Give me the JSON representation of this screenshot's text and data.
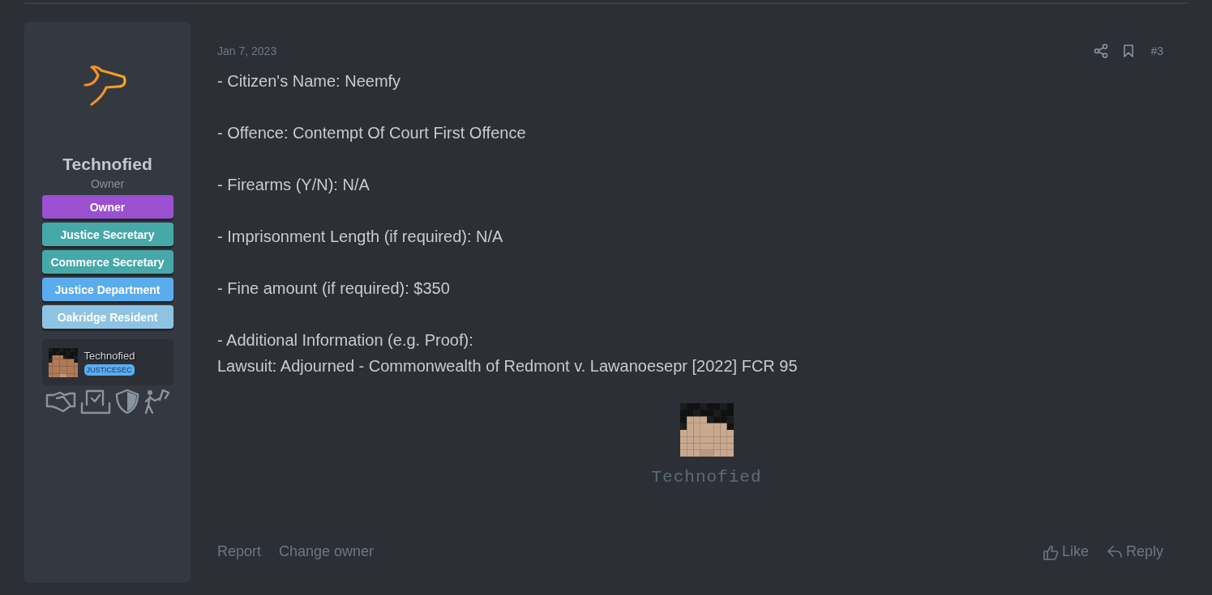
{
  "user": {
    "name": "Technofied",
    "title": "Owner",
    "banners": [
      {
        "label": "Owner",
        "color": "#9b4fd1"
      },
      {
        "label": "Justice Secretary",
        "color": "#46a8a8"
      },
      {
        "label": "Commerce Secretary",
        "color": "#46a8a8"
      },
      {
        "label": "Justice Department",
        "color": "#5aacec"
      },
      {
        "label": "Oakridge Resident",
        "color": "#8ec4e2"
      }
    ],
    "profile_card": {
      "name": "Technofied",
      "tag": "JUSTICESEC"
    }
  },
  "post": {
    "date": "Jan 7, 2023",
    "number": "#3",
    "paragraphs": [
      [
        "- Citizen's Name: Neemfy"
      ],
      [
        "- Offence: Contempt Of Court First Offence"
      ],
      [
        "- Firearms (Y/N): N/A"
      ],
      [
        "- Imprisonment Length (if required): N/A"
      ],
      [
        "- Fine amount (if required): $350"
      ],
      [
        "- Additional Information (e.g. Proof):",
        "Lawsuit: Adjourned - Commonwealth of Redmont v. Lawanoesepr [2022] FCR 95"
      ]
    ],
    "signature": {
      "name": "Technofied"
    },
    "actions_left": [
      "Report",
      "Change owner"
    ],
    "actions_right": [
      {
        "kind": "like",
        "label": "Like"
      },
      {
        "kind": "reply",
        "label": "Reply"
      }
    ]
  }
}
